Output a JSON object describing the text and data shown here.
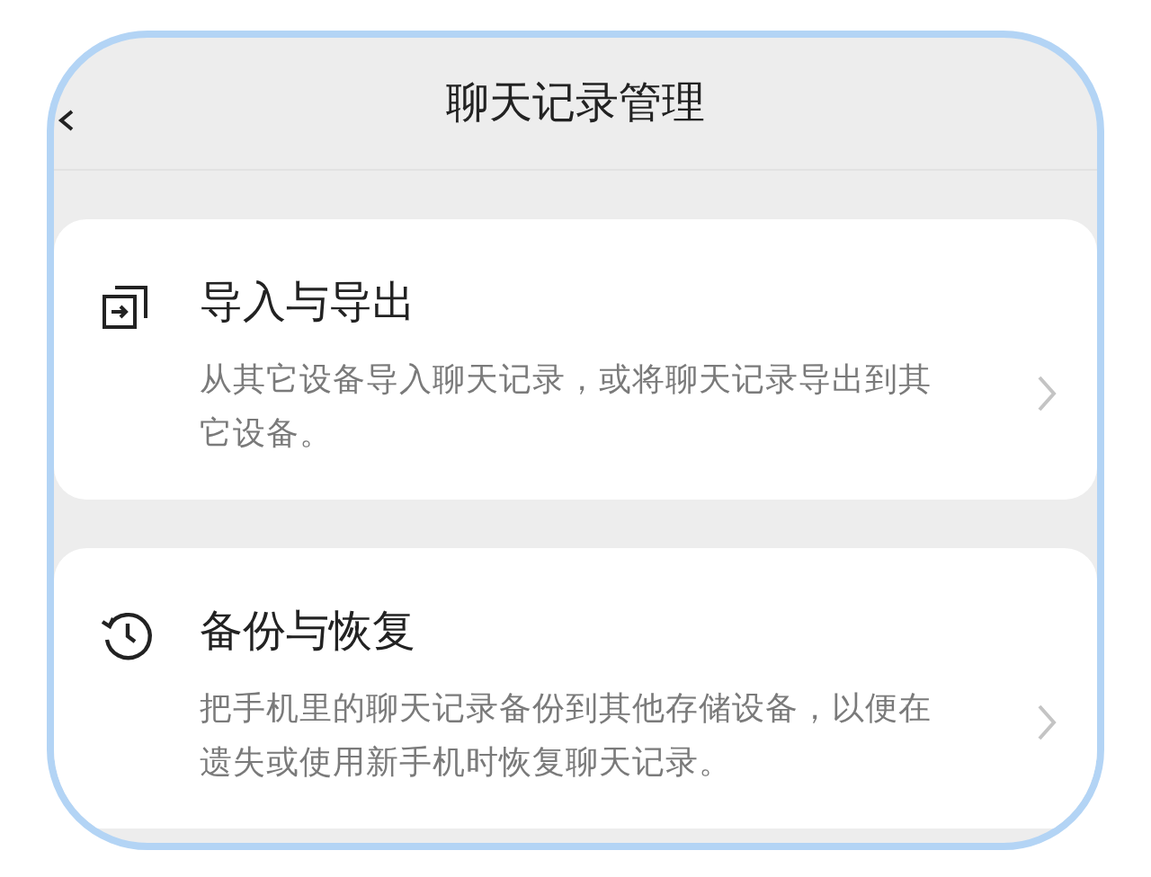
{
  "header": {
    "title": "聊天记录管理"
  },
  "sections": [
    {
      "title": "导入与导出",
      "description": "从其它设备导入聊天记录，或将聊天记录导出到其它设备。"
    },
    {
      "title": "备份与恢复",
      "description": "把手机里的聊天记录备份到其他存储设备，以便在遗失或使用新手机时恢复聊天记录。"
    }
  ]
}
